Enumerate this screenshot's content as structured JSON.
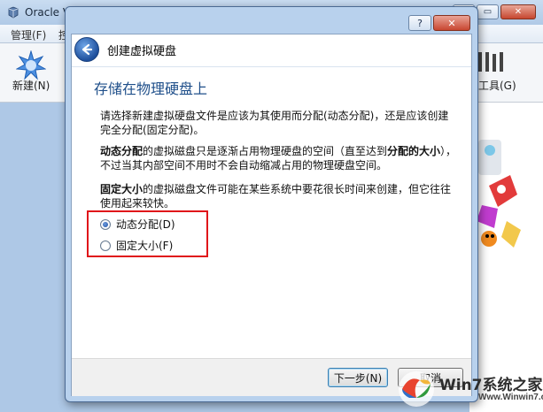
{
  "background_window": {
    "title": "Oracle V",
    "menus": [
      "管理(F)",
      "控"
    ],
    "toolbar": {
      "new_label": "新建(N)",
      "tools_label": "工具(G)"
    }
  },
  "dialog": {
    "controls": {
      "help": "?",
      "close": "✕"
    },
    "wizard_title": "创建虚拟硬盘",
    "page_heading": "存储在物理硬盘上",
    "para1": "请选择新建虚拟硬盘文件是应该为其使用而分配(动态分配)，还是应该创建完全分配(固定分配)。",
    "para2": {
      "b1": "动态分配",
      "t1": "的虚拟磁盘只是逐渐占用物理硬盘的空间（直至达到",
      "b2": "分配的大小",
      "t2": "），不过当其内部空间不用时不会自动缩减占用的物理硬盘空间。"
    },
    "para3": {
      "b1": "固定大小",
      "t1": "的虚拟磁盘文件可能在某些系统中要花很长时间来创建，但它往往使用起来较快。"
    },
    "options": [
      {
        "label": "动态分配(D)",
        "checked": true
      },
      {
        "label": "固定大小(F)",
        "checked": false
      }
    ],
    "buttons": {
      "next": "下一步(N)",
      "cancel": "取消"
    }
  },
  "watermark": {
    "brand": "Win7系统之家",
    "url": "Www.Winwin7.com"
  },
  "colors": {
    "heading": "#1f4f8a",
    "highlight_box": "#e0161a",
    "dialog_frame": "#b8d1ed"
  }
}
